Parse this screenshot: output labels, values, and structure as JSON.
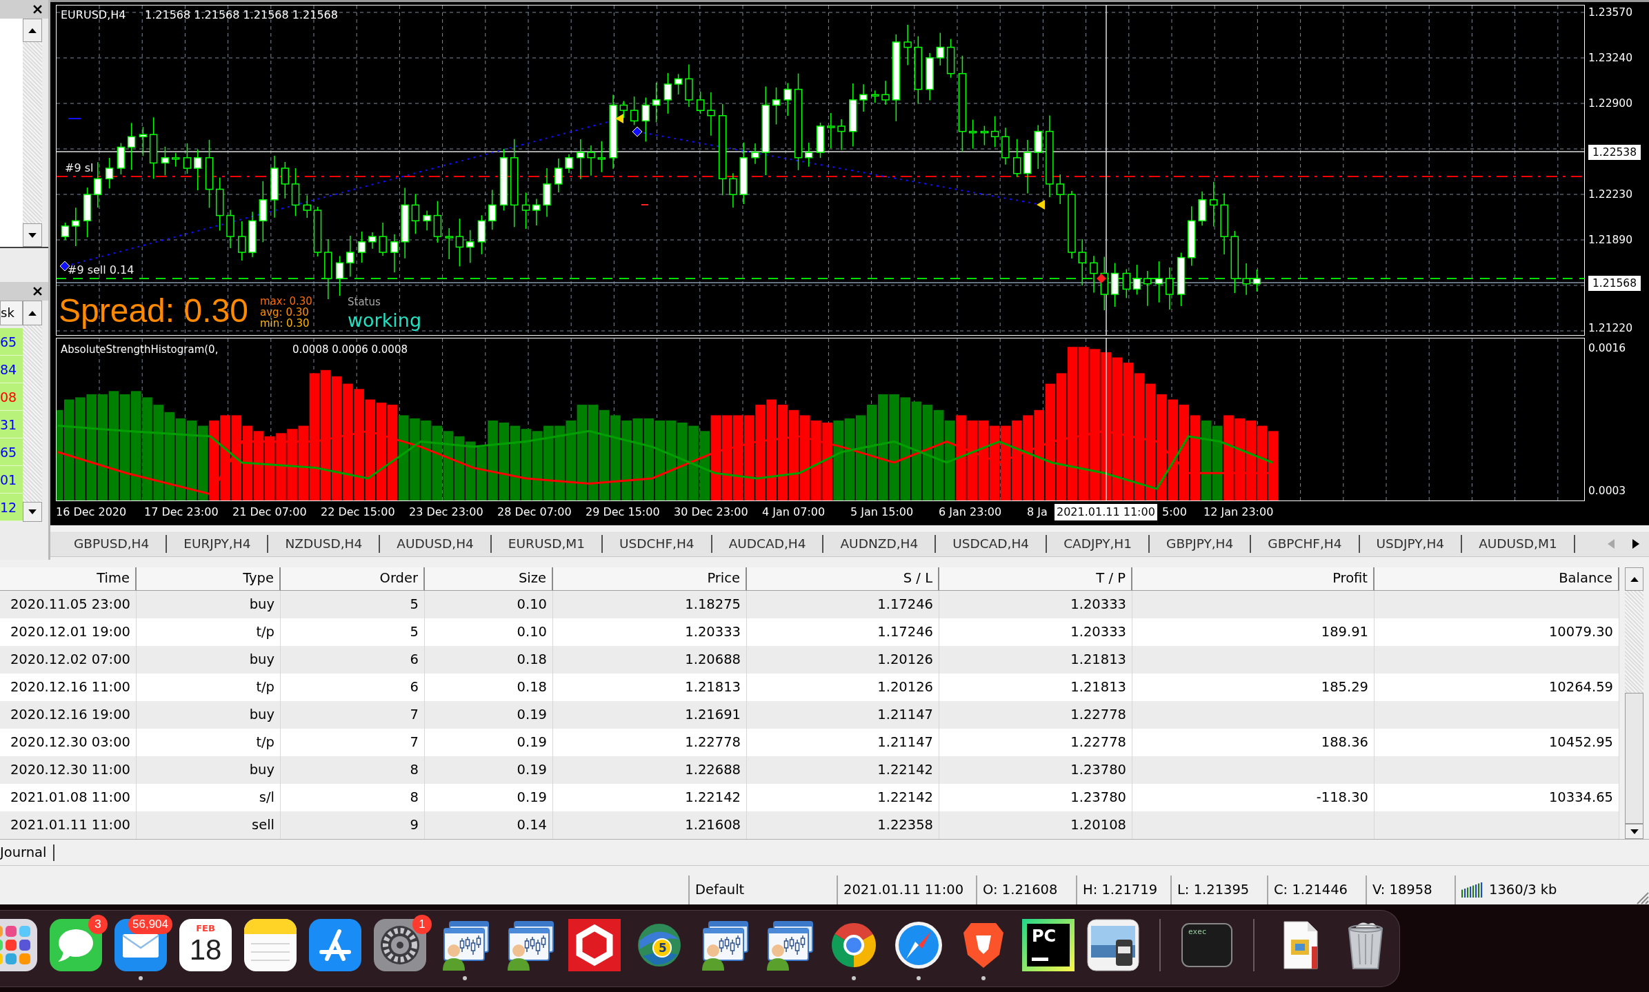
{
  "side_list": {
    "header": "sk",
    "rows": [
      {
        "text": "65",
        "color": "#0000ff"
      },
      {
        "text": "84",
        "color": "#0000ff"
      },
      {
        "text": "08",
        "color": "#ff0000"
      },
      {
        "text": "31",
        "color": "#0000ff"
      },
      {
        "text": "65",
        "color": "#0000ff"
      },
      {
        "text": "01",
        "color": "#0000ff"
      },
      {
        "text": "12",
        "color": "#0000ff"
      }
    ]
  },
  "chart": {
    "symbol": "EURUSD,H4",
    "ohlc": "1.21568 1.21568 1.21568 1.21568",
    "order_labels": [
      "#9 sl",
      "#9 sell 0.14"
    ],
    "spread": "Spread: 0.30",
    "spread_stats": [
      {
        "text": "max: 0.30",
        "color": "#ff6a00"
      },
      {
        "text": "avg: 0.30",
        "color": "#ff9000"
      },
      {
        "text": "min: 0.30",
        "color": "#ffb400"
      }
    ],
    "status_label": "Status",
    "status": "working",
    "price_axis": [
      {
        "text": "1.23570",
        "kind": "tick"
      },
      {
        "text": "1.23240",
        "kind": "tick"
      },
      {
        "text": "1.22900",
        "kind": "tick"
      },
      {
        "text": "1.22538",
        "kind": "marker"
      },
      {
        "text": "1.22230",
        "kind": "tick"
      },
      {
        "text": "1.21890",
        "kind": "tick"
      },
      {
        "text": "1.21568",
        "kind": "marker"
      },
      {
        "text": "1.21220",
        "kind": "tick"
      }
    ],
    "indicator": {
      "name": "AbsoluteStrengthHistogram(0,",
      "values": "0.0008 0.0006 0.0008",
      "axis": [
        "0.0016",
        "0.0003"
      ]
    },
    "time_axis": [
      {
        "text": "16 Dec 2020",
        "kind": "tick"
      },
      {
        "text": "17 Dec 23:00",
        "kind": "tick"
      },
      {
        "text": "21 Dec 07:00",
        "kind": "tick"
      },
      {
        "text": "22 Dec 15:00",
        "kind": "tick"
      },
      {
        "text": "23 Dec 23:00",
        "kind": "tick"
      },
      {
        "text": "28 Dec 07:00",
        "kind": "tick"
      },
      {
        "text": "29 Dec 15:00",
        "kind": "tick"
      },
      {
        "text": "30 Dec 23:00",
        "kind": "tick"
      },
      {
        "text": "4 Jan 07:00",
        "kind": "tick"
      },
      {
        "text": "5 Jan 15:00",
        "kind": "tick"
      },
      {
        "text": "6 Jan 23:00",
        "kind": "tick"
      },
      {
        "text": "8 Ja",
        "kind": "tick"
      },
      {
        "text": "2021.01.11 11:00",
        "kind": "marker"
      },
      {
        "text": "5:00",
        "kind": "tick"
      },
      {
        "text": "12 Jan 23:00",
        "kind": "tick"
      }
    ]
  },
  "symbol_tabs": {
    "tabs": [
      {
        "label": "GBPUSD,H4",
        "selected": false
      },
      {
        "label": "EURJPY,H4",
        "selected": false
      },
      {
        "label": "NZDUSD,H4",
        "selected": false
      },
      {
        "label": "AUDUSD,H4",
        "selected": false
      },
      {
        "label": "EURUSD,M1",
        "selected": false
      },
      {
        "label": "USDCHF,H4",
        "selected": false
      },
      {
        "label": "AUDCAD,H4",
        "selected": false
      },
      {
        "label": "AUDNZD,H4",
        "selected": false
      },
      {
        "label": "USDCAD,H4",
        "selected": false
      },
      {
        "label": "CADJPY,H1",
        "selected": false
      },
      {
        "label": "GBPJPY,H4",
        "selected": false
      },
      {
        "label": "GBPCHF,H4",
        "selected": false
      },
      {
        "label": "USDJPY,H4",
        "selected": false
      },
      {
        "label": "AUDUSD,M1",
        "selected": false
      }
    ],
    "scroll_left": {
      "disabled": true
    },
    "scroll_right": {
      "disabled": false
    }
  },
  "history_table": {
    "columns": [
      "Time",
      "Type",
      "Order",
      "Size",
      "Price",
      "S / L",
      "T / P",
      "Profit",
      "Balance"
    ],
    "rows": [
      {
        "time": "2020.11.05 23:00",
        "type": "buy",
        "order": "5",
        "size": "0.10",
        "price": "1.18275",
        "sl": "1.17246",
        "tp": "1.20333"
      },
      {
        "time": "2020.12.01 19:00",
        "type": "t/p",
        "order": "5",
        "size": "0.10",
        "price": "1.20333",
        "sl": "1.17246",
        "tp": "1.20333",
        "profit": "189.91",
        "balance": "10079.30"
      },
      {
        "time": "2020.12.02 07:00",
        "type": "buy",
        "order": "6",
        "size": "0.18",
        "price": "1.20688",
        "sl": "1.20126",
        "tp": "1.21813"
      },
      {
        "time": "2020.12.16 11:00",
        "type": "t/p",
        "order": "6",
        "size": "0.18",
        "price": "1.21813",
        "sl": "1.20126",
        "tp": "1.21813",
        "profit": "185.29",
        "balance": "10264.59"
      },
      {
        "time": "2020.12.16 19:00",
        "type": "buy",
        "order": "7",
        "size": "0.19",
        "price": "1.21691",
        "sl": "1.21147",
        "tp": "1.22778"
      },
      {
        "time": "2020.12.30 03:00",
        "type": "t/p",
        "order": "7",
        "size": "0.19",
        "price": "1.22778",
        "sl": "1.21147",
        "tp": "1.22778",
        "profit": "188.36",
        "balance": "10452.95"
      },
      {
        "time": "2020.12.30 11:00",
        "type": "buy",
        "order": "8",
        "size": "0.19",
        "price": "1.22688",
        "sl": "1.22142",
        "tp": "1.23780"
      },
      {
        "time": "2021.01.08 11:00",
        "type": "s/l",
        "order": "8",
        "size": "0.19",
        "price": "1.22142",
        "sl": "1.22142",
        "tp": "1.23780",
        "profit": "-118.30",
        "balance": "10334.65"
      },
      {
        "time": "2021.01.11 11:00",
        "type": "sell",
        "order": "9",
        "size": "0.14",
        "price": "1.21608",
        "sl": "1.22358",
        "tp": "1.20108"
      }
    ]
  },
  "bottom_tabs": [
    {
      "label": "Journal",
      "selected": false
    }
  ],
  "status_bar": {
    "fields": [
      "Default",
      "2021.01.11 11:00",
      "O: 1.21608",
      "H: 1.21719",
      "L: 1.21395",
      "C: 1.21446",
      "V: 18958"
    ],
    "traffic": "1360/3 kb"
  },
  "dock": {
    "groups": [
      {
        "items": [
          {
            "kind": "app-grid",
            "running": false
          },
          {
            "kind": "chat",
            "badge": "3",
            "running": false
          },
          {
            "kind": "mail",
            "badge": "56,904",
            "running": true
          },
          {
            "kind": "calendar",
            "month": "FEB",
            "day": "18",
            "running": false
          },
          {
            "kind": "notes",
            "running": false
          },
          {
            "kind": "store",
            "running": false
          },
          {
            "kind": "gear",
            "badge": "1",
            "running": false
          },
          {
            "kind": "tester",
            "running": true
          },
          {
            "kind": "tester",
            "running": false
          },
          {
            "kind": "hexagon",
            "running": false
          },
          {
            "kind": "globe",
            "label": "5",
            "running": false
          },
          {
            "kind": "tester",
            "running": false
          },
          {
            "kind": "tester",
            "running": false
          },
          {
            "kind": "ring",
            "running": true
          },
          {
            "kind": "compass",
            "running": true
          },
          {
            "kind": "shield",
            "running": true
          },
          {
            "kind": "code",
            "label": "PC",
            "running": false
          },
          {
            "kind": "photo",
            "running": false
          }
        ]
      },
      {
        "items": [
          {
            "kind": "terminal",
            "label": "exec",
            "running": false
          }
        ]
      },
      {
        "items": [
          {
            "kind": "document",
            "running": false
          },
          {
            "kind": "trash",
            "running": false
          }
        ]
      }
    ]
  }
}
